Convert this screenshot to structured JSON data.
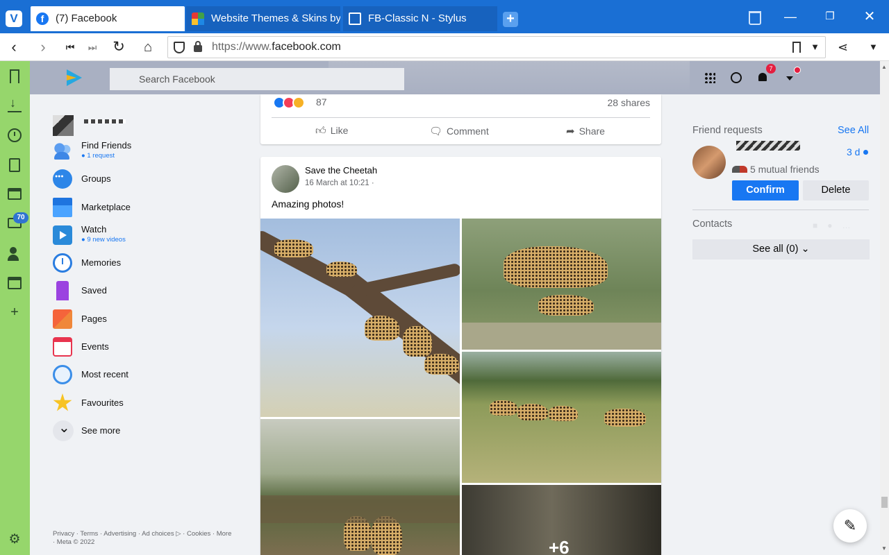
{
  "browser": {
    "tabs": [
      {
        "title": "(7) Facebook",
        "favicon": "facebook-icon",
        "active": true
      },
      {
        "title": "Website Themes & Skins by",
        "favicon": "userstyles-icon",
        "active": false
      },
      {
        "title": "FB-Classic N - Stylus",
        "favicon": "document-icon",
        "active": false
      }
    ],
    "url_prefix": "https://www.",
    "url_domain": "facebook.com",
    "accent_color": "#1a6fd4",
    "panel_color": "#96d66c",
    "mail_badge": "70"
  },
  "fb": {
    "search_placeholder": "Search Facebook",
    "notifications_badge": "7",
    "nav": [
      {
        "label": "Find Friends",
        "sub": "● 1 request",
        "icon": "find-friends-icon"
      },
      {
        "label": "Groups",
        "icon": "groups-icon"
      },
      {
        "label": "Marketplace",
        "icon": "marketplace-icon"
      },
      {
        "label": "Watch",
        "sub": "● 9 new videos",
        "icon": "watch-icon"
      },
      {
        "label": "Memories",
        "icon": "memories-icon"
      },
      {
        "label": "Saved",
        "icon": "saved-icon"
      },
      {
        "label": "Pages",
        "icon": "pages-icon"
      },
      {
        "label": "Events",
        "icon": "events-icon"
      },
      {
        "label": "Most recent",
        "icon": "most-recent-icon"
      },
      {
        "label": "Favourites",
        "icon": "favourites-icon"
      },
      {
        "label": "See more",
        "icon": "chevron-down-icon"
      }
    ],
    "footer": "Privacy · Terms · Advertising · Ad choices ▷ · Cookies · More · Meta © 2022"
  },
  "post1": {
    "reactions_count": "87",
    "shares": "28 shares",
    "actions": {
      "like": "Like",
      "comment": "Comment",
      "share": "Share"
    }
  },
  "post2": {
    "author": "Save the Cheetah",
    "time": "16 March at 10:21 ·",
    "text": "Amazing photos!",
    "more_photos": "+6"
  },
  "right": {
    "friend_requests_title": "Friend requests",
    "see_all": "See All",
    "request_time": "3 d",
    "mutual_friends": "5 mutual friends",
    "confirm": "Confirm",
    "delete": "Delete",
    "contacts_title": "Contacts",
    "contacts_see_all": "See all (0) ⌄"
  }
}
